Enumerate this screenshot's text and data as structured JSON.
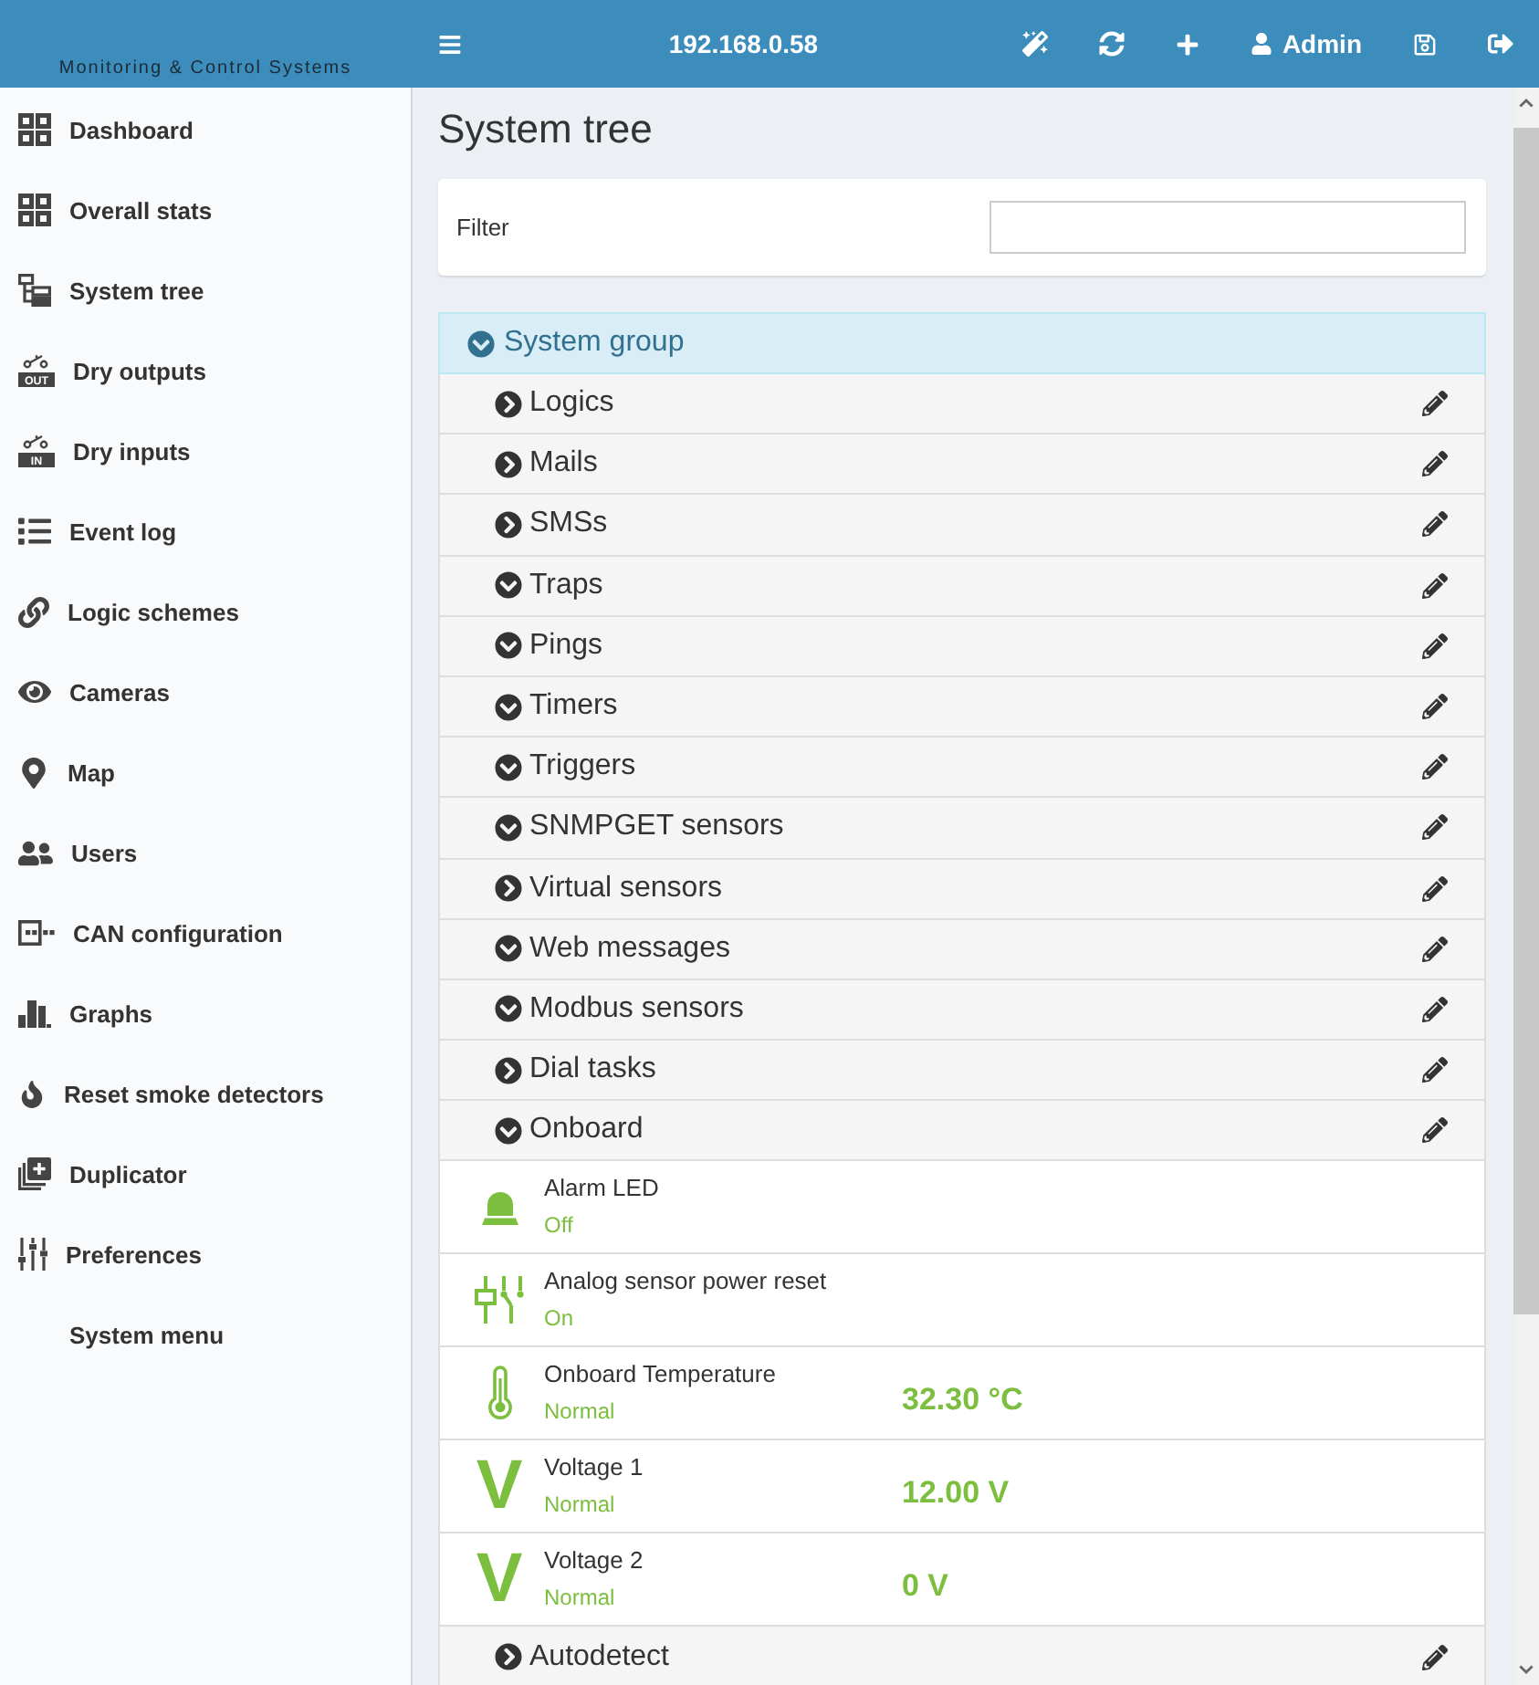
{
  "topbar": {
    "logo_text": "Monitoring & Control Systems",
    "address": "192.168.0.58",
    "user": "Admin"
  },
  "sidebar": {
    "items": [
      {
        "label": "Dashboard"
      },
      {
        "label": "Overall stats"
      },
      {
        "label": "System tree"
      },
      {
        "label": "Dry outputs",
        "badge": "OUT"
      },
      {
        "label": "Dry inputs",
        "badge": "IN"
      },
      {
        "label": "Event log"
      },
      {
        "label": "Logic schemes"
      },
      {
        "label": "Cameras"
      },
      {
        "label": "Map"
      },
      {
        "label": "Users"
      },
      {
        "label": "CAN configuration"
      },
      {
        "label": "Graphs"
      },
      {
        "label": "Reset smoke detectors"
      },
      {
        "label": "Duplicator"
      },
      {
        "label": "Preferences"
      },
      {
        "label": "System menu"
      }
    ]
  },
  "page": {
    "title": "System tree"
  },
  "filter": {
    "label": "Filter"
  },
  "tree": {
    "label": "System group",
    "expanded": true,
    "children": [
      {
        "label": "Logics",
        "expanded": false
      },
      {
        "label": "Mails",
        "expanded": false
      },
      {
        "label": "SMSs",
        "expanded": false
      },
      {
        "label": "Traps",
        "expanded": true
      },
      {
        "label": "Pings",
        "expanded": true
      },
      {
        "label": "Timers",
        "expanded": true
      },
      {
        "label": "Triggers",
        "expanded": true
      },
      {
        "label": "SNMPGET sensors",
        "expanded": true
      },
      {
        "label": "Virtual sensors",
        "expanded": false
      },
      {
        "label": "Web messages",
        "expanded": true
      },
      {
        "label": "Modbus sensors",
        "expanded": true
      },
      {
        "label": "Dial tasks",
        "expanded": false
      },
      {
        "label": "Onboard",
        "expanded": true,
        "children": [
          {
            "name": "Alarm LED",
            "status": "Off"
          },
          {
            "name": "Analog sensor power reset",
            "status": "On"
          },
          {
            "name": "Onboard Temperature",
            "status": "Normal",
            "value": "32.30 °C"
          },
          {
            "name": "Voltage 1",
            "status": "Normal",
            "value": "12.00 V",
            "symbol": "V"
          },
          {
            "name": "Voltage 2",
            "status": "Normal",
            "value": "0 V",
            "symbol": "V"
          }
        ]
      },
      {
        "label": "Autodetect",
        "expanded": false
      }
    ]
  }
}
